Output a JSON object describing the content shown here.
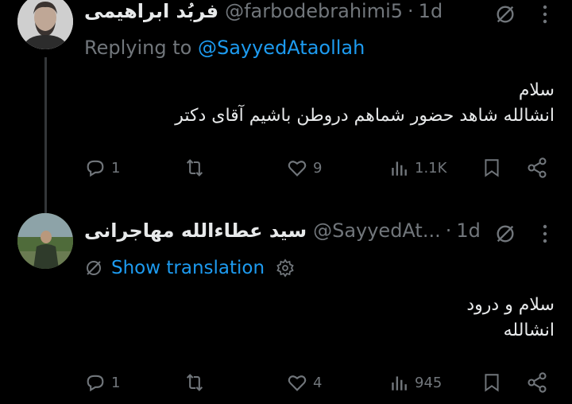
{
  "tweets": [
    {
      "author_name": "فربُد ابراهیمی",
      "handle": "@farbodebrahimi5",
      "separator": "·",
      "time": "1d",
      "replying_prefix": "Replying to",
      "replying_to": "@SayyedAtaollah",
      "lines": [
        "سلام",
        "انشالله شاهد حضور شماهم دروطن باشیم آقای دکتر"
      ],
      "replies": "1",
      "retweets": "",
      "likes": "9",
      "views": "1.1K"
    },
    {
      "author_name": "سید عطاءالله مهاجرانی",
      "handle": "@SayyedAt...",
      "separator": "·",
      "time": "1d",
      "translate_label": "Show translation",
      "lines": [
        "سلام و درود",
        "انشالله"
      ],
      "replies": "1",
      "retweets": "",
      "likes": "4",
      "views": "945"
    }
  ],
  "icons": {
    "reply": "reply-icon",
    "retweet": "retweet-icon",
    "like": "like-icon",
    "views": "views-icon",
    "bookmark": "bookmark-icon",
    "share": "share-icon",
    "grok": "grok-icon",
    "more": "more-icon",
    "translate": "translate-icon",
    "settings": "settings-icon"
  },
  "colors": {
    "background": "#000000",
    "text": "#e7e9ea",
    "muted": "#71767b",
    "accent": "#1d9bf0",
    "thread_line": "#333639"
  }
}
